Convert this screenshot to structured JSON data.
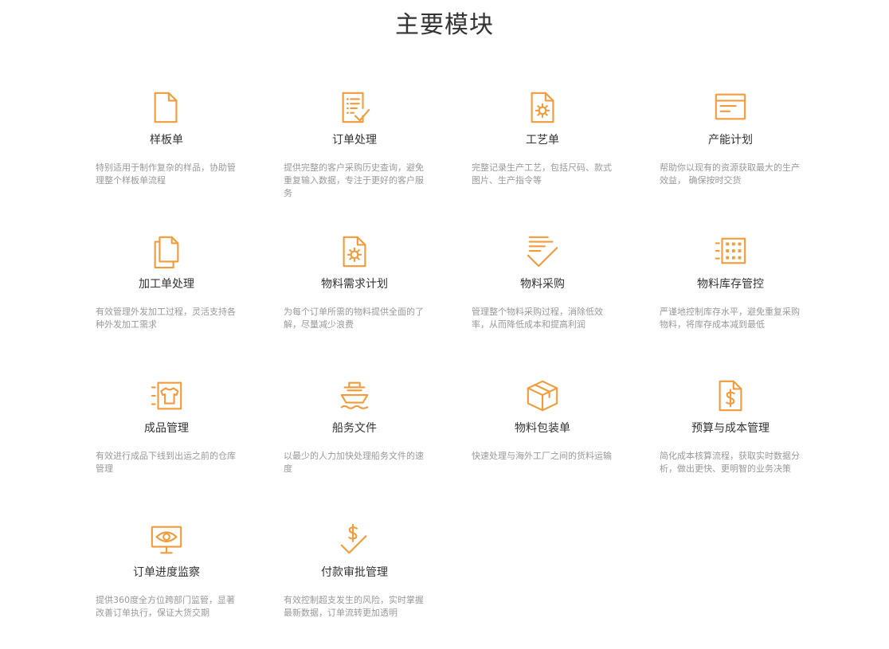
{
  "page": {
    "title": "主要模块"
  },
  "theme": {
    "accent": "#f29b3a",
    "title_color": "#333333",
    "desc_color": "#999999"
  },
  "modules": [
    {
      "icon": "document-icon",
      "title": "样板单",
      "desc": "特别适用于制作复杂的样品，协助管理整个样板单流程"
    },
    {
      "icon": "checklist-icon",
      "title": "订单处理",
      "desc": "提供完整的客户采购历史查询，避免重复输入数据，专注于更好的客户服务"
    },
    {
      "icon": "document-gear-icon",
      "title": "工艺单",
      "desc": "完整记录生产工艺，包括尺码、款式图片、生产指令等"
    },
    {
      "icon": "browser-window-icon",
      "title": "产能计划",
      "desc": "帮助你以现有的资源获取最大的生产效益， 确保按时交货"
    },
    {
      "icon": "documents-stack-icon",
      "title": "加工单处理",
      "desc": "有效管理外发加工过程，灵活支持各种外发加工需求"
    },
    {
      "icon": "document-gear-icon",
      "title": "物料需求计划",
      "desc": "为每个订单所需的物料提供全面的了解，尽量减少浪费"
    },
    {
      "icon": "list-check-icon",
      "title": "物料采购",
      "desc": "管理整个物料采购过程，消除低效率，从而降低成本和提高利润"
    },
    {
      "icon": "warehouse-grid-icon",
      "title": "物料库存管控",
      "desc": "严谨地控制库存水平，避免重复采购物料，将库存成本减到最低"
    },
    {
      "icon": "tshirt-frame-icon",
      "title": "成品管理",
      "desc": "有效进行成品下线到出运之前的仓库管理"
    },
    {
      "icon": "ship-icon",
      "title": "船务文件",
      "desc": "以最少的人力加快处理船务文件的速度"
    },
    {
      "icon": "package-box-icon",
      "title": "物料包装单",
      "desc": "快速处理与海外工厂之间的货料运输"
    },
    {
      "icon": "document-dollar-icon",
      "title": "预算与成本管理",
      "desc": "简化成本核算流程，获取实时数据分析，做出更快、更明智的业务决策"
    },
    {
      "icon": "monitor-eye-icon",
      "title": "订单进度监察",
      "desc": "提供360度全方位跨部门监管，显著改善订单执行，保证大货交期"
    },
    {
      "icon": "dollar-check-icon",
      "title": "付款审批管理",
      "desc": "有效控制超支发生的风险，实时掌握最新数据，订单流转更加透明"
    }
  ]
}
